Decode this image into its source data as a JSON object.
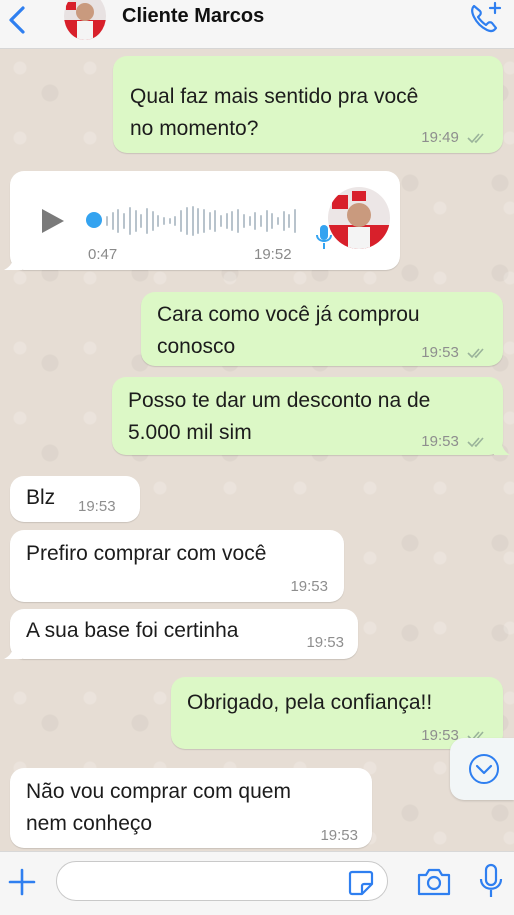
{
  "header": {
    "title": "Cliente Marcos",
    "back_icon": "chevron-left-icon",
    "call_icon": "phone-plus-icon",
    "accent_color": "#2f7ff0"
  },
  "messages": [
    {
      "direction": "out",
      "text_lines": [
        "Qual faz mais sentido pra você",
        "no momento?"
      ],
      "time": "19:49"
    },
    {
      "direction": "in",
      "type": "voice",
      "duration": "0:47",
      "time": "19:52"
    },
    {
      "direction": "out",
      "text_lines": [
        "Cara como você já comprou",
        "conosco"
      ],
      "time": "19:53"
    },
    {
      "direction": "out",
      "text_lines": [
        "Posso te dar um desconto na de",
        "5.000 mil sim"
      ],
      "time": "19:53"
    },
    {
      "direction": "in",
      "text_lines": [
        "Blz"
      ],
      "time": "19:53"
    },
    {
      "direction": "in",
      "text_lines": [
        "Prefiro comprar com você"
      ],
      "time": "19:53"
    },
    {
      "direction": "in",
      "text_lines": [
        "A sua base foi certinha"
      ],
      "time": "19:53"
    },
    {
      "direction": "out",
      "text_lines": [
        "Obrigado, pela confiança!!"
      ],
      "time": "19:53"
    },
    {
      "direction": "in",
      "text_lines": [
        "Não vou comprar com quem",
        "nem conheço"
      ],
      "time": "19:53"
    }
  ],
  "input_bar": {
    "placeholder": "",
    "icons": [
      "plus-icon",
      "sticker-icon",
      "camera-icon",
      "microphone-icon"
    ]
  },
  "colors": {
    "outgoing_bubble": "#dcf8c6",
    "incoming_bubble": "#ffffff",
    "wallpaper": "#e6ddd4",
    "voice_dot": "#34a3f0"
  }
}
